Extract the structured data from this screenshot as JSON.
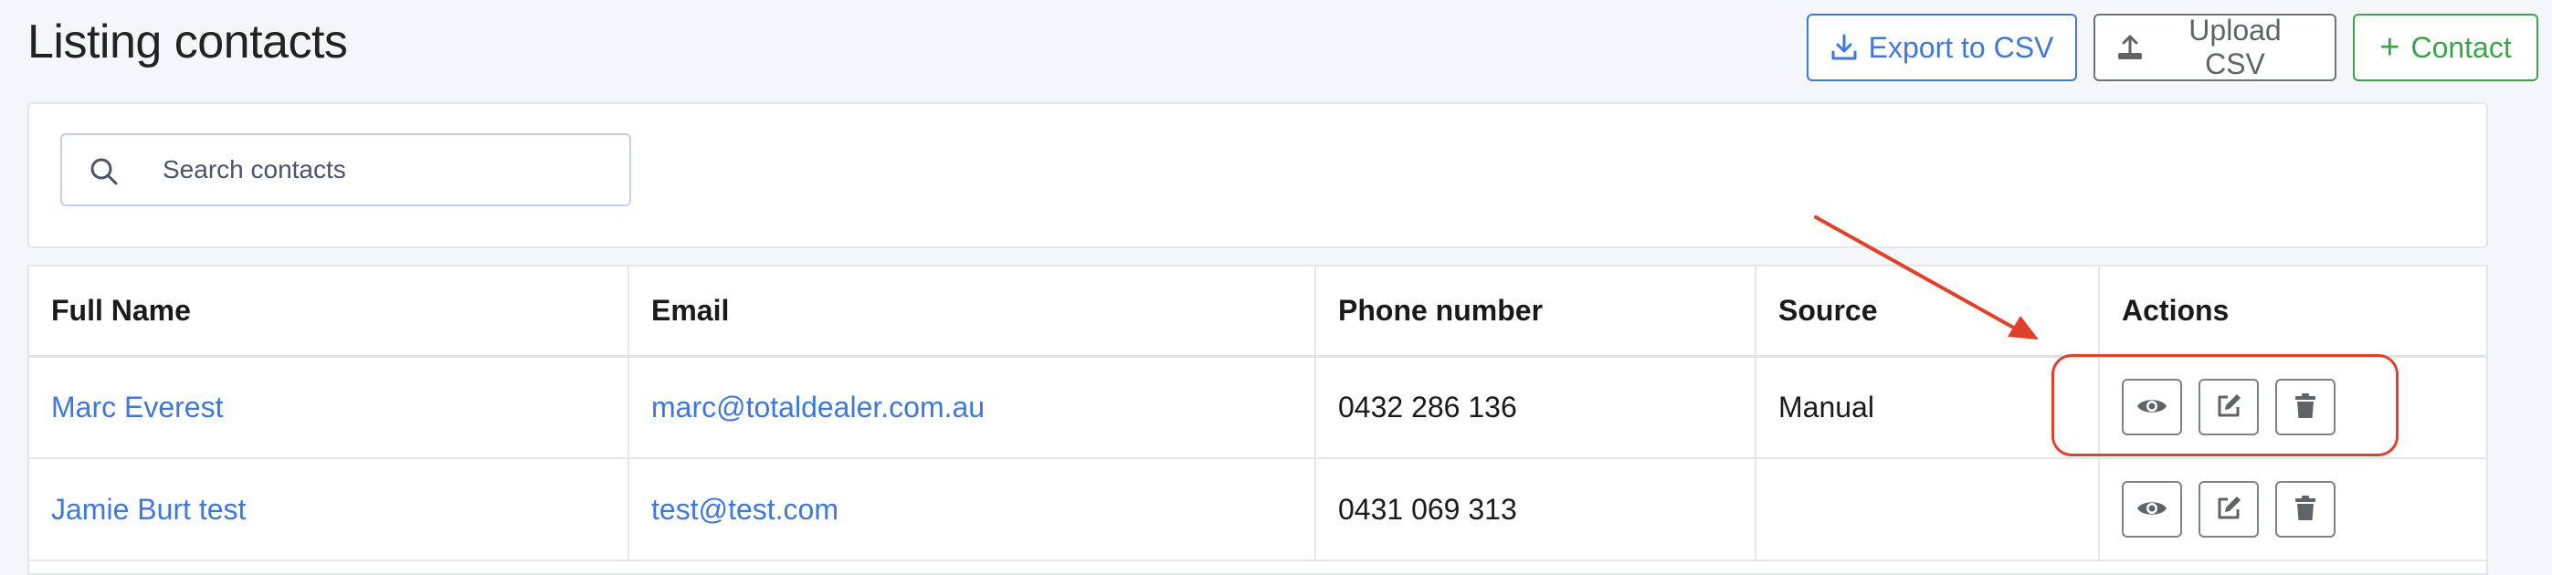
{
  "page": {
    "title": "Listing contacts"
  },
  "toolbar": {
    "export_label": "Export to CSV",
    "upload_label": "Upload CSV",
    "contact_label": "Contact",
    "contact_prefix": "+"
  },
  "search": {
    "placeholder": "Search contacts",
    "value": ""
  },
  "table": {
    "headers": [
      "Full Name",
      "Email",
      "Phone number",
      "Source",
      "Actions"
    ],
    "rows": [
      {
        "full_name": "Marc Everest",
        "email": "marc@totaldealer.com.au",
        "phone": "0432 286 136",
        "source": "Manual"
      },
      {
        "full_name": "Jamie Burt test",
        "email": "test@test.com",
        "phone": "0431 069 313",
        "source": ""
      }
    ]
  },
  "colors": {
    "primary": "#3f78d8",
    "secondary": "#6c757d",
    "success": "#3aa34b",
    "annotation": "#e0412a"
  },
  "icons": {
    "export": "download-icon",
    "upload": "upload-icon",
    "contact": "plus-icon",
    "search": "search-icon",
    "view": "eye-icon",
    "edit": "edit-icon",
    "delete": "trash-icon"
  }
}
